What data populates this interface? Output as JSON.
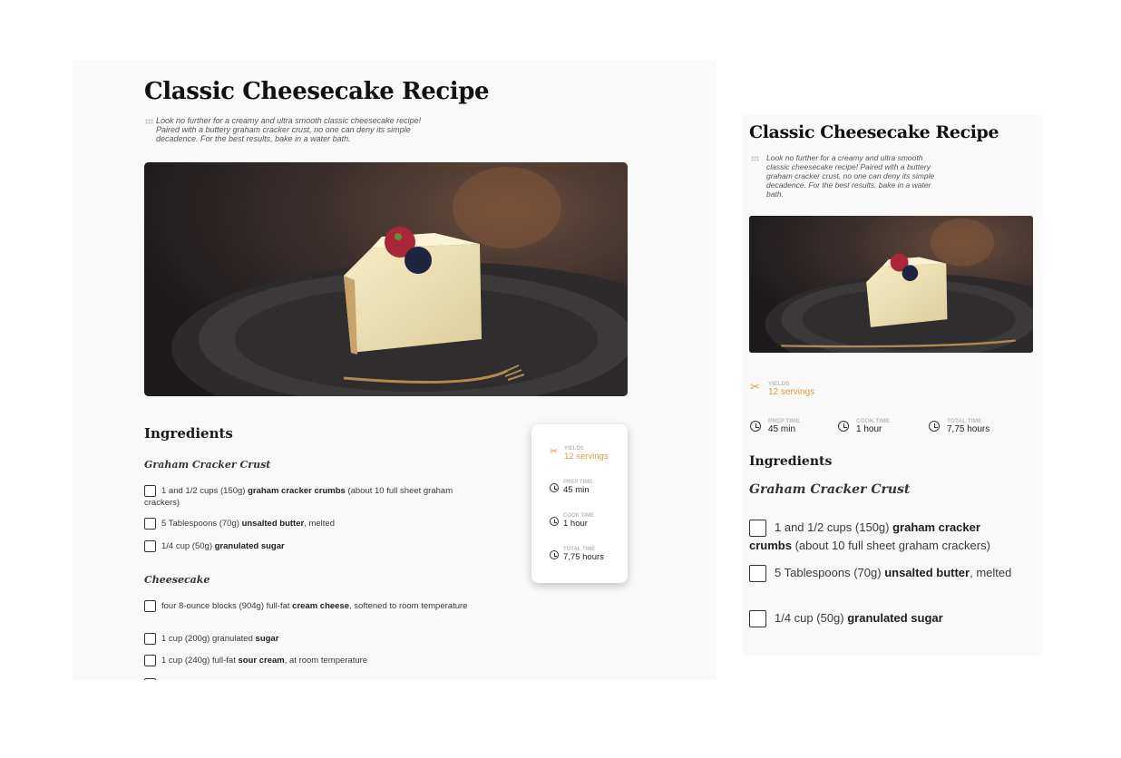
{
  "recipe": {
    "title": "Classic Cheesecake Recipe",
    "description": "Look no further for a creamy and ultra smooth classic cheesecake recipe! Paired with a buttery graham cracker crust, no one can deny its simple decadence. For the best results, bake in a water bath.",
    "description_mobile_lines": [
      "Look no further for a creamy and ultra smooth",
      "classic cheesecake recipe! Paired with a buttery",
      "graham cracker crust, no one can deny its simple",
      "decadence. For the best results, bake in a water",
      "bath."
    ],
    "description_desktop_lines": [
      "Look no further for a creamy and ultra smooth classic cheesecake recipe!",
      "Paired with a buttery graham cracker crust, no one can deny its simple",
      "decadence. For the best results, bake in a water bath."
    ],
    "image_alt": "Slice of cheesecake topped with a raspberry and blueberry on a dark plate with a gold fork"
  },
  "meta": {
    "yields": {
      "label": "YIELDS",
      "value": "12 servings",
      "icon": "utensils-icon"
    },
    "prep": {
      "label": "PREP TIME",
      "value": "45 min",
      "icon": "clock-icon"
    },
    "cook": {
      "label": "COOK TIME",
      "value": "1 hour",
      "icon": "clock-icon"
    },
    "total": {
      "label": "TOTAL TIME",
      "value": "7,75 hours",
      "icon": "clock-icon"
    }
  },
  "ingredients": {
    "heading": "Ingredients",
    "crust": {
      "heading": "Graham Cracker Crust",
      "items": [
        {
          "pre": "1 and 1/2 cups (150g) ",
          "bold": "graham cracker crumbs",
          "post": " (about 10 full sheet graham crackers)"
        },
        {
          "pre": "5 Tablespoons (70g) ",
          "bold": "unsalted butter",
          "post": ", melted"
        },
        {
          "pre": "1/4 cup (50g) ",
          "bold": "granulated sugar",
          "post": ""
        }
      ]
    },
    "cheesecake": {
      "heading": "Cheesecake",
      "items": [
        {
          "pre": "four 8-ounce blocks (904g) full-fat ",
          "bold": "cream cheese",
          "post": ", softened to room temperature"
        },
        {
          "pre": "1 cup (200g) granulated ",
          "bold": "sugar",
          "post": ""
        },
        {
          "pre": "1 cup (240g) full-fat ",
          "bold": "sour cream",
          "post": ", at room temperature"
        }
      ]
    }
  },
  "colors": {
    "accent": "#e9953e",
    "panel_bg": "#f9f9f9",
    "text": "#2b2b2b"
  }
}
